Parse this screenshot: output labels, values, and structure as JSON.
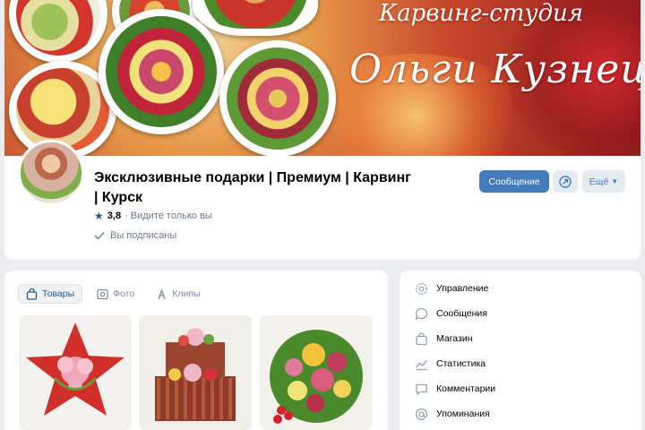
{
  "cover": {
    "script_line1": "Карвинг-студия",
    "script_line2": "Ольги Кузнецовой"
  },
  "group": {
    "title": "Эксклюзивные подарки | Премиум | Карвинг | Курск",
    "rating": "3,8",
    "rating_note": "· Видите только вы",
    "subscribed": "Вы подписаны"
  },
  "actions": {
    "message_label": "Сообщение",
    "more_label": "Ещё"
  },
  "tabs": [
    {
      "label": "Товары",
      "icon": "bag-icon",
      "active": true
    },
    {
      "label": "Фото",
      "icon": "photo-icon",
      "active": false
    },
    {
      "label": "Клипы",
      "icon": "clips-icon",
      "active": false
    }
  ],
  "menu": [
    {
      "label": "Управление",
      "icon": "gear-icon"
    },
    {
      "label": "Сообщения",
      "icon": "message-icon"
    },
    {
      "label": "Магазин",
      "icon": "shop-bag-icon"
    },
    {
      "label": "Статистика",
      "icon": "stats-icon"
    },
    {
      "label": "Комментарии",
      "icon": "comment-icon"
    },
    {
      "label": "Упоминания",
      "icon": "mention-icon"
    }
  ],
  "colors": {
    "accent": "#447bba",
    "link": "#2a5885",
    "background": "#ebedf0",
    "muted": "#818c99"
  }
}
